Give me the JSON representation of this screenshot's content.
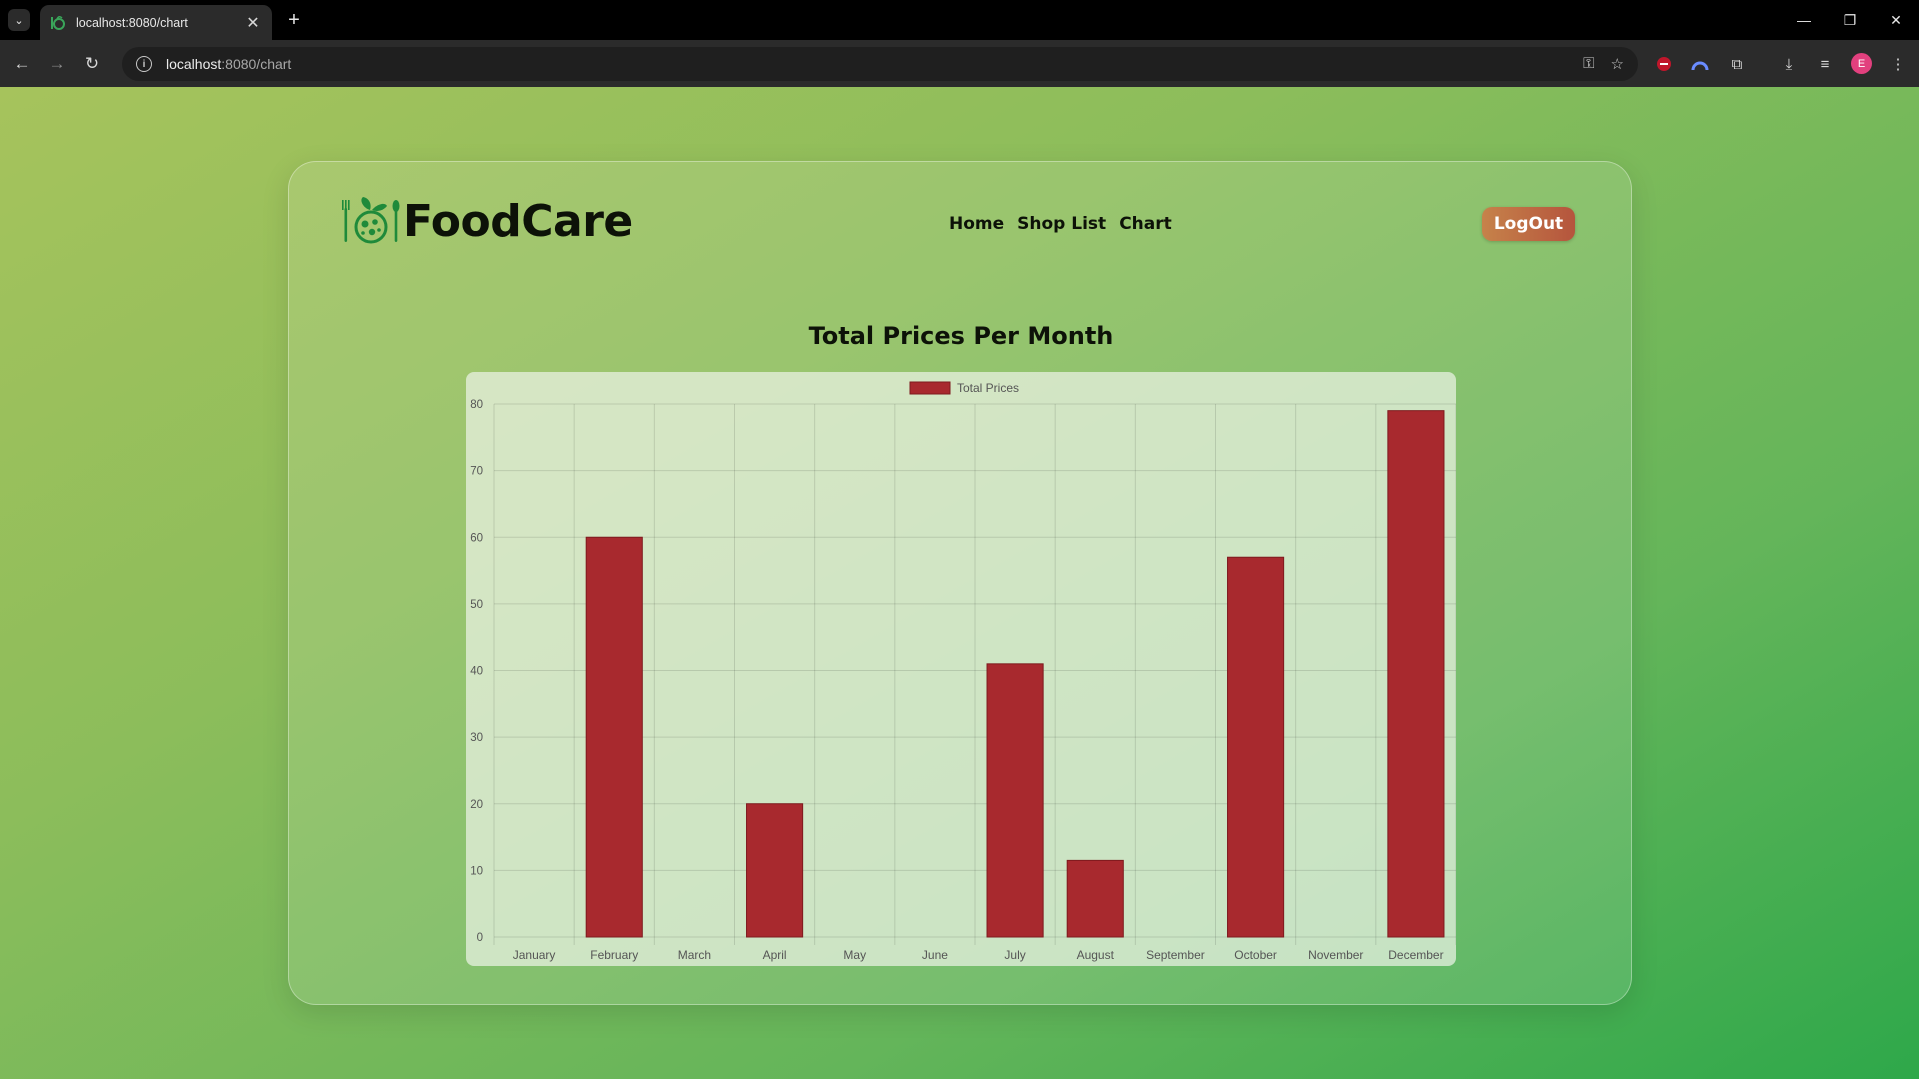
{
  "browser": {
    "tab_title": "localhost:8080/chart",
    "url_host": "localhost",
    "url_path": ":8080/chart",
    "profile_initial": "E"
  },
  "site": {
    "brand": "FoodCare",
    "nav": [
      "Home",
      "Shop List",
      "Chart"
    ],
    "logout_label": "LogOut"
  },
  "colors": {
    "bar_fill": "#a8292e",
    "bar_stroke": "#7e1a1e",
    "logo_green": "#1f8a3a"
  },
  "chart_data": {
    "type": "bar",
    "title": "Total Prices Per Month",
    "legend": {
      "position": "top",
      "entries": [
        "Total Prices"
      ]
    },
    "categories": [
      "January",
      "February",
      "March",
      "April",
      "May",
      "June",
      "July",
      "August",
      "September",
      "October",
      "November",
      "December"
    ],
    "series": [
      {
        "name": "Total Prices",
        "values": [
          0,
          60,
          0,
          20,
          0,
          0,
          41,
          11.5,
          0,
          57,
          0,
          79
        ]
      }
    ],
    "ylim": [
      0,
      80
    ],
    "yticks": [
      0,
      10,
      20,
      30,
      40,
      50,
      60,
      70,
      80
    ],
    "grid": true
  }
}
